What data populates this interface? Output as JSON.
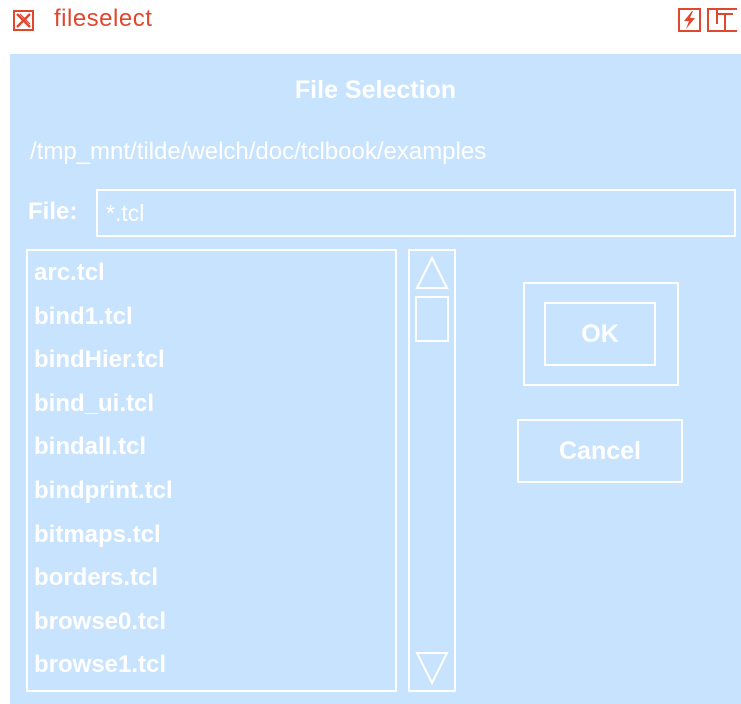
{
  "window": {
    "title": "fileselect",
    "close_icon": "x-close-icon",
    "zap_icon": "lightning-icon",
    "maximize_icon": "maximize-icon"
  },
  "dialog": {
    "heading": "File Selection",
    "path": "/tmp_mnt/tilde/welch/doc/tclbook/examples",
    "file_label": "File:",
    "file_value": "*.tcl",
    "files": [
      "arc.tcl",
      "bind1.tcl",
      "bindHier.tcl",
      "bind_ui.tcl",
      "bindall.tcl",
      "bindprint.tcl",
      "bitmaps.tcl",
      "borders.tcl",
      "browse0.tcl",
      "browse1.tcl"
    ],
    "ok_label": "OK",
    "cancel_label": "Cancel"
  },
  "colors": {
    "background": "#c7e3fd",
    "foreground": "#ffffff",
    "titlebar_accent": "#e0472f"
  }
}
